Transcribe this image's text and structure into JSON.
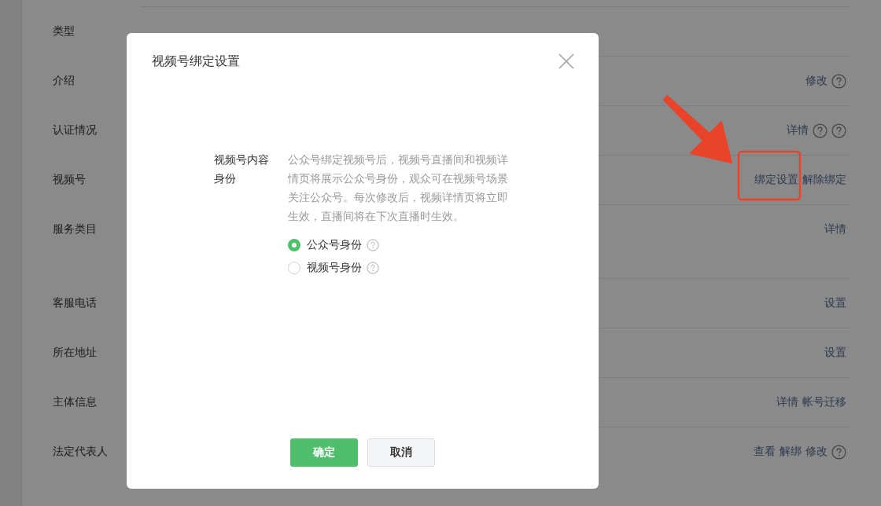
{
  "page": {
    "rows": [
      {
        "label": "类型",
        "actions": []
      },
      {
        "label": "介绍",
        "actions": [
          {
            "kind": "link",
            "text": "修改"
          },
          {
            "kind": "help"
          }
        ]
      },
      {
        "label": "认证情况",
        "actions": [
          {
            "kind": "link",
            "text": "详情"
          },
          {
            "kind": "help"
          },
          {
            "kind": "help"
          }
        ]
      },
      {
        "label": "视频号",
        "actions": [
          {
            "kind": "link",
            "text": "绑定设置"
          },
          {
            "kind": "link",
            "text": "解除绑定"
          }
        ]
      },
      {
        "label": "服务类目",
        "actions": [
          {
            "kind": "link",
            "text": "详情"
          }
        ]
      },
      {
        "label": "客服电话",
        "actions": [
          {
            "kind": "link",
            "text": "设置"
          }
        ]
      },
      {
        "label": "所在地址",
        "actions": [
          {
            "kind": "link",
            "text": "设置"
          }
        ]
      },
      {
        "label": "主体信息",
        "actions": [
          {
            "kind": "link",
            "text": "详情"
          },
          {
            "kind": "link",
            "text": "帐号迁移"
          }
        ]
      },
      {
        "label": "法定代表人",
        "actions": [
          {
            "kind": "link",
            "text": "查看"
          },
          {
            "kind": "link",
            "text": "解绑"
          },
          {
            "kind": "link",
            "text": "修改"
          },
          {
            "kind": "help"
          }
        ]
      }
    ]
  },
  "dialog": {
    "title": "视频号绑定设置",
    "field_label": "视频号内容身份",
    "description": "公众号绑定视频号后，视频号直播间和视频详情页将展示公众号身份，观众可在视频号场景关注公众号。每次修改后，视频详情页将立即生效，直播间将在下次直播时生效。",
    "options": [
      {
        "label": "公众号身份",
        "selected": true,
        "help": true
      },
      {
        "label": "视频号身份",
        "selected": false,
        "help": true
      }
    ],
    "buttons": [
      {
        "text": "确定",
        "kind": "primary"
      },
      {
        "text": "取消",
        "kind": "default"
      }
    ]
  }
}
